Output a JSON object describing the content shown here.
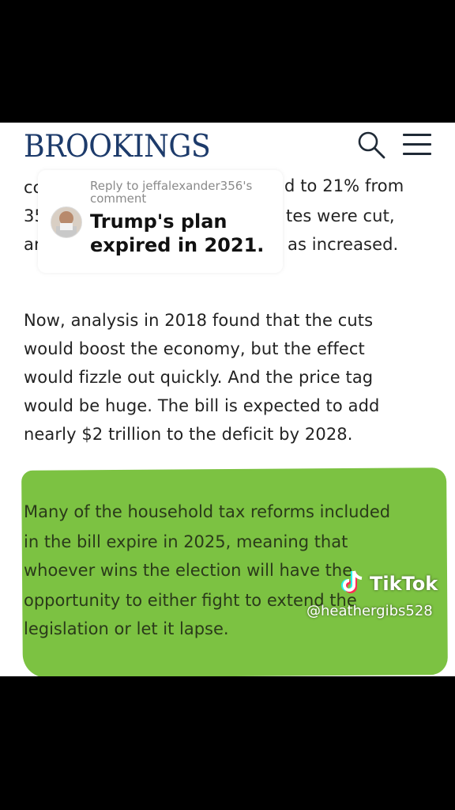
{
  "header": {
    "logo": "BROOKINGS",
    "search_icon": "search-icon",
    "menu_icon": "hamburger-menu-icon",
    "brand_color": "#1d3b6b"
  },
  "article": {
    "hidden_lines": [
      "cc",
      "35",
      "ar"
    ],
    "visible_right": [
      "d to 21% from",
      "tes were cut,",
      "as increased."
    ],
    "paragraph2": [
      "Now, analysis in 2018 found that the cuts",
      "would boost the economy, but the effect",
      "would fizzle out quickly. And the price tag",
      "would be huge. The bill is expected to add",
      "nearly $2 trillion to the deficit by 2028."
    ],
    "paragraph3": [
      "Many of the household tax reforms included",
      "in the bill expire in 2025, meaning that",
      "whoever wins the election will have the",
      "opportunity to either fight to extend the",
      "legislation or let it lapse."
    ],
    "highlight_color": "#7cc242"
  },
  "reply_overlay": {
    "label": "Reply to jeffalexander356's comment",
    "text": "Trump's plan expired in 2021."
  },
  "watermark": {
    "brand": "TikTok",
    "username": "@heathergibs528"
  }
}
